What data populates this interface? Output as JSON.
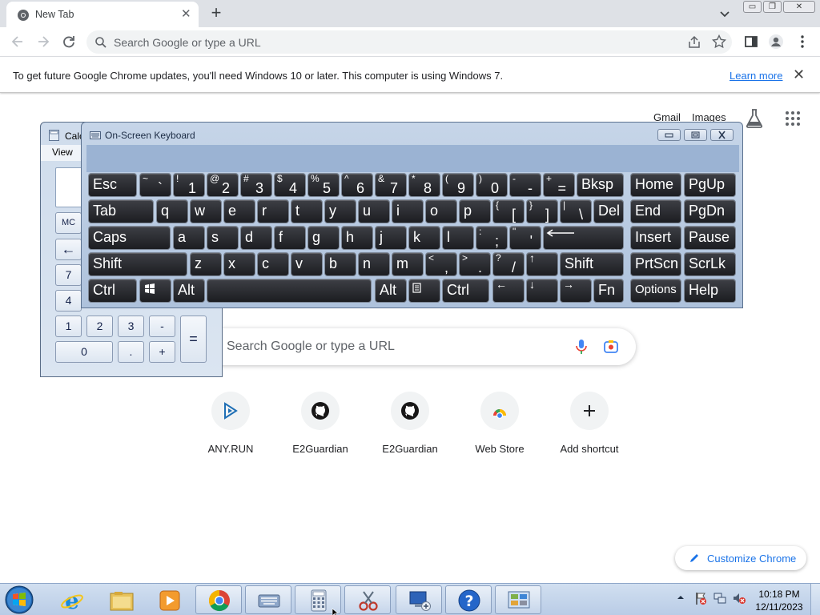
{
  "browser": {
    "tab": {
      "title": "New Tab",
      "close_glyph": "✕"
    },
    "new_tab_glyph": "+",
    "omnibox": {
      "placeholder": "Search Google or type a URL"
    },
    "window_controls": {
      "minimize": "▭",
      "restore": "❐",
      "close": "✕"
    },
    "infobar": {
      "message": "To get future Google Chrome updates, you'll need Windows 10 or later. This computer is using Windows 7.",
      "link": "Learn more",
      "close_glyph": "✕"
    }
  },
  "ntp": {
    "header_links": {
      "gmail": "Gmail",
      "images": "Images"
    },
    "search_placeholder": "Search Google or type a URL",
    "shortcuts": [
      {
        "label": "ANY.RUN",
        "icon": "anyrun-icon"
      },
      {
        "label": "E2Guardian",
        "icon": "github-icon"
      },
      {
        "label": "E2Guardian",
        "icon": "github-icon"
      },
      {
        "label": "Web Store",
        "icon": "web-store-icon"
      },
      {
        "label": "Add shortcut",
        "icon": "plus-icon"
      }
    ],
    "customize_label": "Customize Chrome"
  },
  "calculator": {
    "title": "Calc",
    "menu_view": "View",
    "buttons": {
      "mc": "MC",
      "back": "←",
      "seven": "7",
      "four": "4",
      "one": "1",
      "two": "2",
      "three": "3",
      "minus": "-",
      "zero": "0",
      "dot": ".",
      "plus": "+",
      "equals": "="
    }
  },
  "osk": {
    "title": "On-Screen Keyboard",
    "keys": {
      "esc": "Esc",
      "tab": "Tab",
      "caps": "Caps",
      "shift_l": "Shift",
      "ctrl_l": "Ctrl",
      "alt_l": "Alt",
      "bksp": "Bksp",
      "del": "Del",
      "shift_r": "Shift",
      "alt_r": "Alt",
      "ctrl_r": "Ctrl",
      "fn": "Fn",
      "home": "Home",
      "pgup": "PgUp",
      "end": "End",
      "pgdn": "PgDn",
      "insert": "Insert",
      "pause": "Pause",
      "prtscn": "PrtScn",
      "scrlk": "ScrLk",
      "options": "Options",
      "help": "Help",
      "up": "↑",
      "left": "←",
      "down": "↓",
      "right": "→",
      "q": "q",
      "w": "w",
      "e": "e",
      "r": "r",
      "t": "t",
      "y": "y",
      "u": "u",
      "i": "i",
      "o": "o",
      "p": "p",
      "a": "a",
      "s": "s",
      "d": "d",
      "f": "f",
      "g": "g",
      "h": "h",
      "j": "j",
      "k": "k",
      "l": "l",
      "z": "z",
      "x": "x",
      "c": "c",
      "v": "v",
      "b": "b",
      "n": "n",
      "m": "m"
    },
    "dual_keys": {
      "grave": {
        "shift": "~",
        "low": "`"
      },
      "d1": {
        "shift": "!",
        "low": "1"
      },
      "d2": {
        "shift": "@",
        "low": "2"
      },
      "d3": {
        "shift": "#",
        "low": "3"
      },
      "d4": {
        "shift": "$",
        "low": "4"
      },
      "d5": {
        "shift": "%",
        "low": "5"
      },
      "d6": {
        "shift": "^",
        "low": "6"
      },
      "d7": {
        "shift": "&",
        "low": "7"
      },
      "d8": {
        "shift": "*",
        "low": "8"
      },
      "d9": {
        "shift": "(",
        "low": "9"
      },
      "d0": {
        "shift": ")",
        "low": "0"
      },
      "minus": {
        "shift": "-",
        "low": "-"
      },
      "equal": {
        "shift": "+",
        "low": "="
      },
      "lbracket": {
        "shift": "{",
        "low": "["
      },
      "rbracket": {
        "shift": "}",
        "low": "]"
      },
      "backslash": {
        "shift": "|",
        "low": "\\"
      },
      "semicolon": {
        "shift": ":",
        "low": ";"
      },
      "quote": {
        "shift": "\"",
        "low": "'"
      },
      "comma": {
        "shift": "<",
        "low": ","
      },
      "period": {
        "shift": ">",
        "low": "."
      },
      "slash": {
        "shift": "?",
        "low": "/"
      }
    }
  },
  "taskbar": {
    "apps": [
      "internet-explorer-icon",
      "file-explorer-icon",
      "media-player-icon",
      "chrome-icon",
      "on-screen-keyboard-icon",
      "calculator-icon",
      "snipping-tool-icon",
      "remote-desktop-icon",
      "help-icon",
      "control-panel-icon"
    ],
    "clock_time": "10:18 PM",
    "clock_date": "12/11/2023"
  }
}
